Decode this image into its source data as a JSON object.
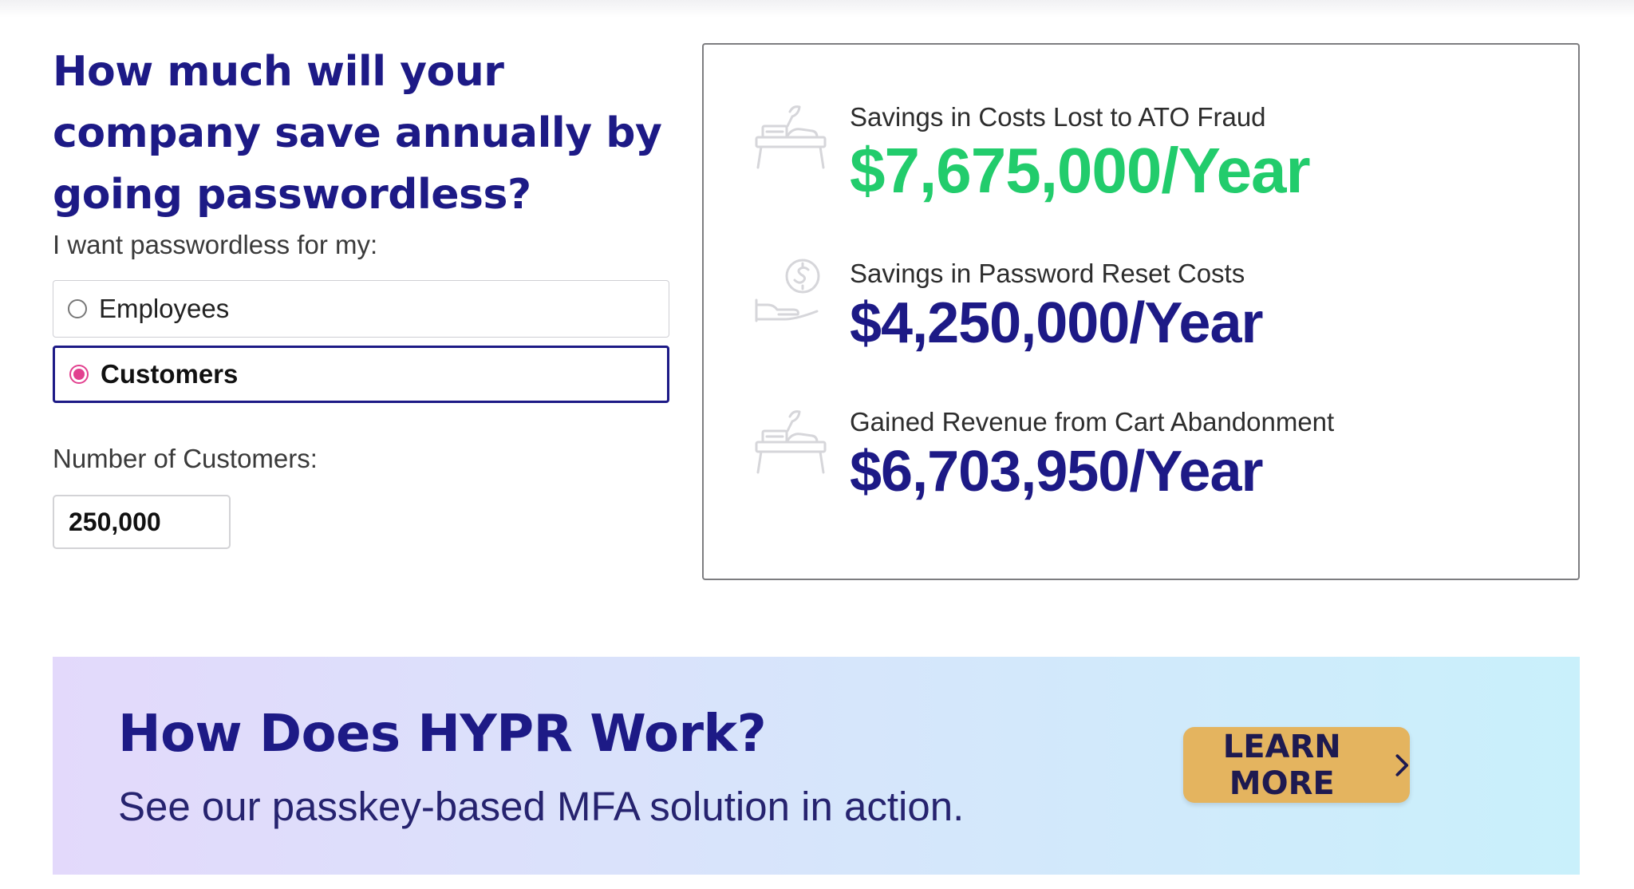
{
  "form": {
    "heading": "How much will your company save annually by going passwordless?",
    "prompt": "I want passwordless for my:",
    "options": [
      {
        "label": "Employees",
        "selected": false
      },
      {
        "label": "Customers",
        "selected": true
      }
    ],
    "count_label": "Number of Customers:",
    "count_value": "250,000"
  },
  "results": [
    {
      "label": "Savings in Costs Lost to ATO Fraud",
      "value": "$7,675,000/Year",
      "icon": "desk-icon",
      "color": "#22cc6c"
    },
    {
      "label": "Savings in Password Reset Costs",
      "value": "$4,250,000/Year",
      "icon": "dollar-hand-icon",
      "color": "#1d1a86"
    },
    {
      "label": "Gained Revenue from Cart Abandonment",
      "value": "$6,703,950/Year",
      "icon": "desk-icon",
      "color": "#1d1a86"
    }
  ],
  "banner": {
    "title": "How Does HYPR Work?",
    "subtitle": "See our passkey-based MFA solution in action.",
    "button_label": "LEARN MORE",
    "button_icon": "chevron-right-icon"
  },
  "colors": {
    "brand": "#1d1a86",
    "positive": "#22cc6c",
    "radio_accent": "#e2408f",
    "button": "#e4b45f"
  }
}
